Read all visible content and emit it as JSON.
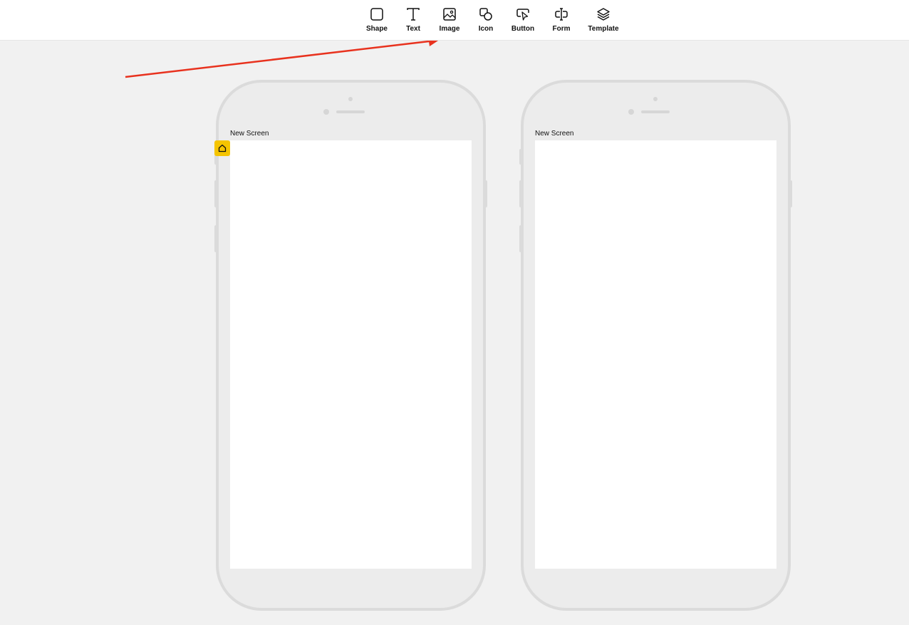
{
  "toolbar": {
    "tools": [
      {
        "label": "Shape",
        "icon": "square-icon"
      },
      {
        "label": "Text",
        "icon": "text-icon"
      },
      {
        "label": "Image",
        "icon": "image-icon"
      },
      {
        "label": "Icon",
        "icon": "shapes-icon"
      },
      {
        "label": "Button",
        "icon": "cursor-click-icon"
      },
      {
        "label": "Form",
        "icon": "text-cursor-field-icon"
      },
      {
        "label": "Template",
        "icon": "layers-icon"
      }
    ]
  },
  "screens": [
    {
      "title": "New Screen",
      "is_home": true
    },
    {
      "title": "New Screen",
      "is_home": false
    }
  ],
  "colors": {
    "annotation_arrow": "#e8321e",
    "home_badge": "#f5c400",
    "canvas": "#f1f1f1",
    "device_frame": "#dbdbdb"
  }
}
